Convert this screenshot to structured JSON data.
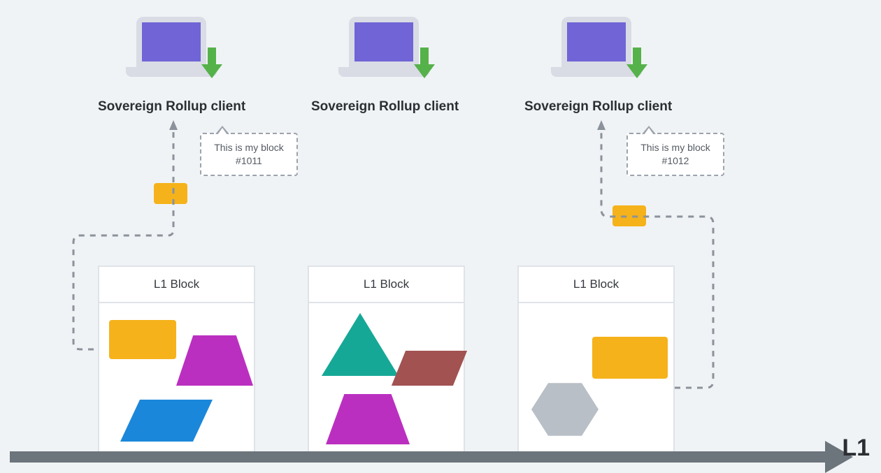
{
  "clients": [
    {
      "label": "Sovereign Rollup client"
    },
    {
      "label": "Sovereign Rollup client"
    },
    {
      "label": "Sovereign Rollup client"
    }
  ],
  "speech": {
    "left": {
      "line1": "This is my block",
      "line2": "#1011"
    },
    "right": {
      "line1": "This is my block",
      "line2": "#1012"
    }
  },
  "blocks": [
    {
      "header": "L1 Block"
    },
    {
      "header": "L1 Block"
    },
    {
      "header": "L1 Block"
    }
  ],
  "axis": {
    "label": "L1"
  },
  "colors": {
    "yellow": "#f5b21a",
    "purple": "#bb2fc0",
    "blue": "#1b87da",
    "teal": "#16a896",
    "brown": "#a15251",
    "gray_shape": "#b8bfc6",
    "axis": "#6c747c",
    "screen": "#7064d6",
    "arrow_green": "#55b24a"
  }
}
